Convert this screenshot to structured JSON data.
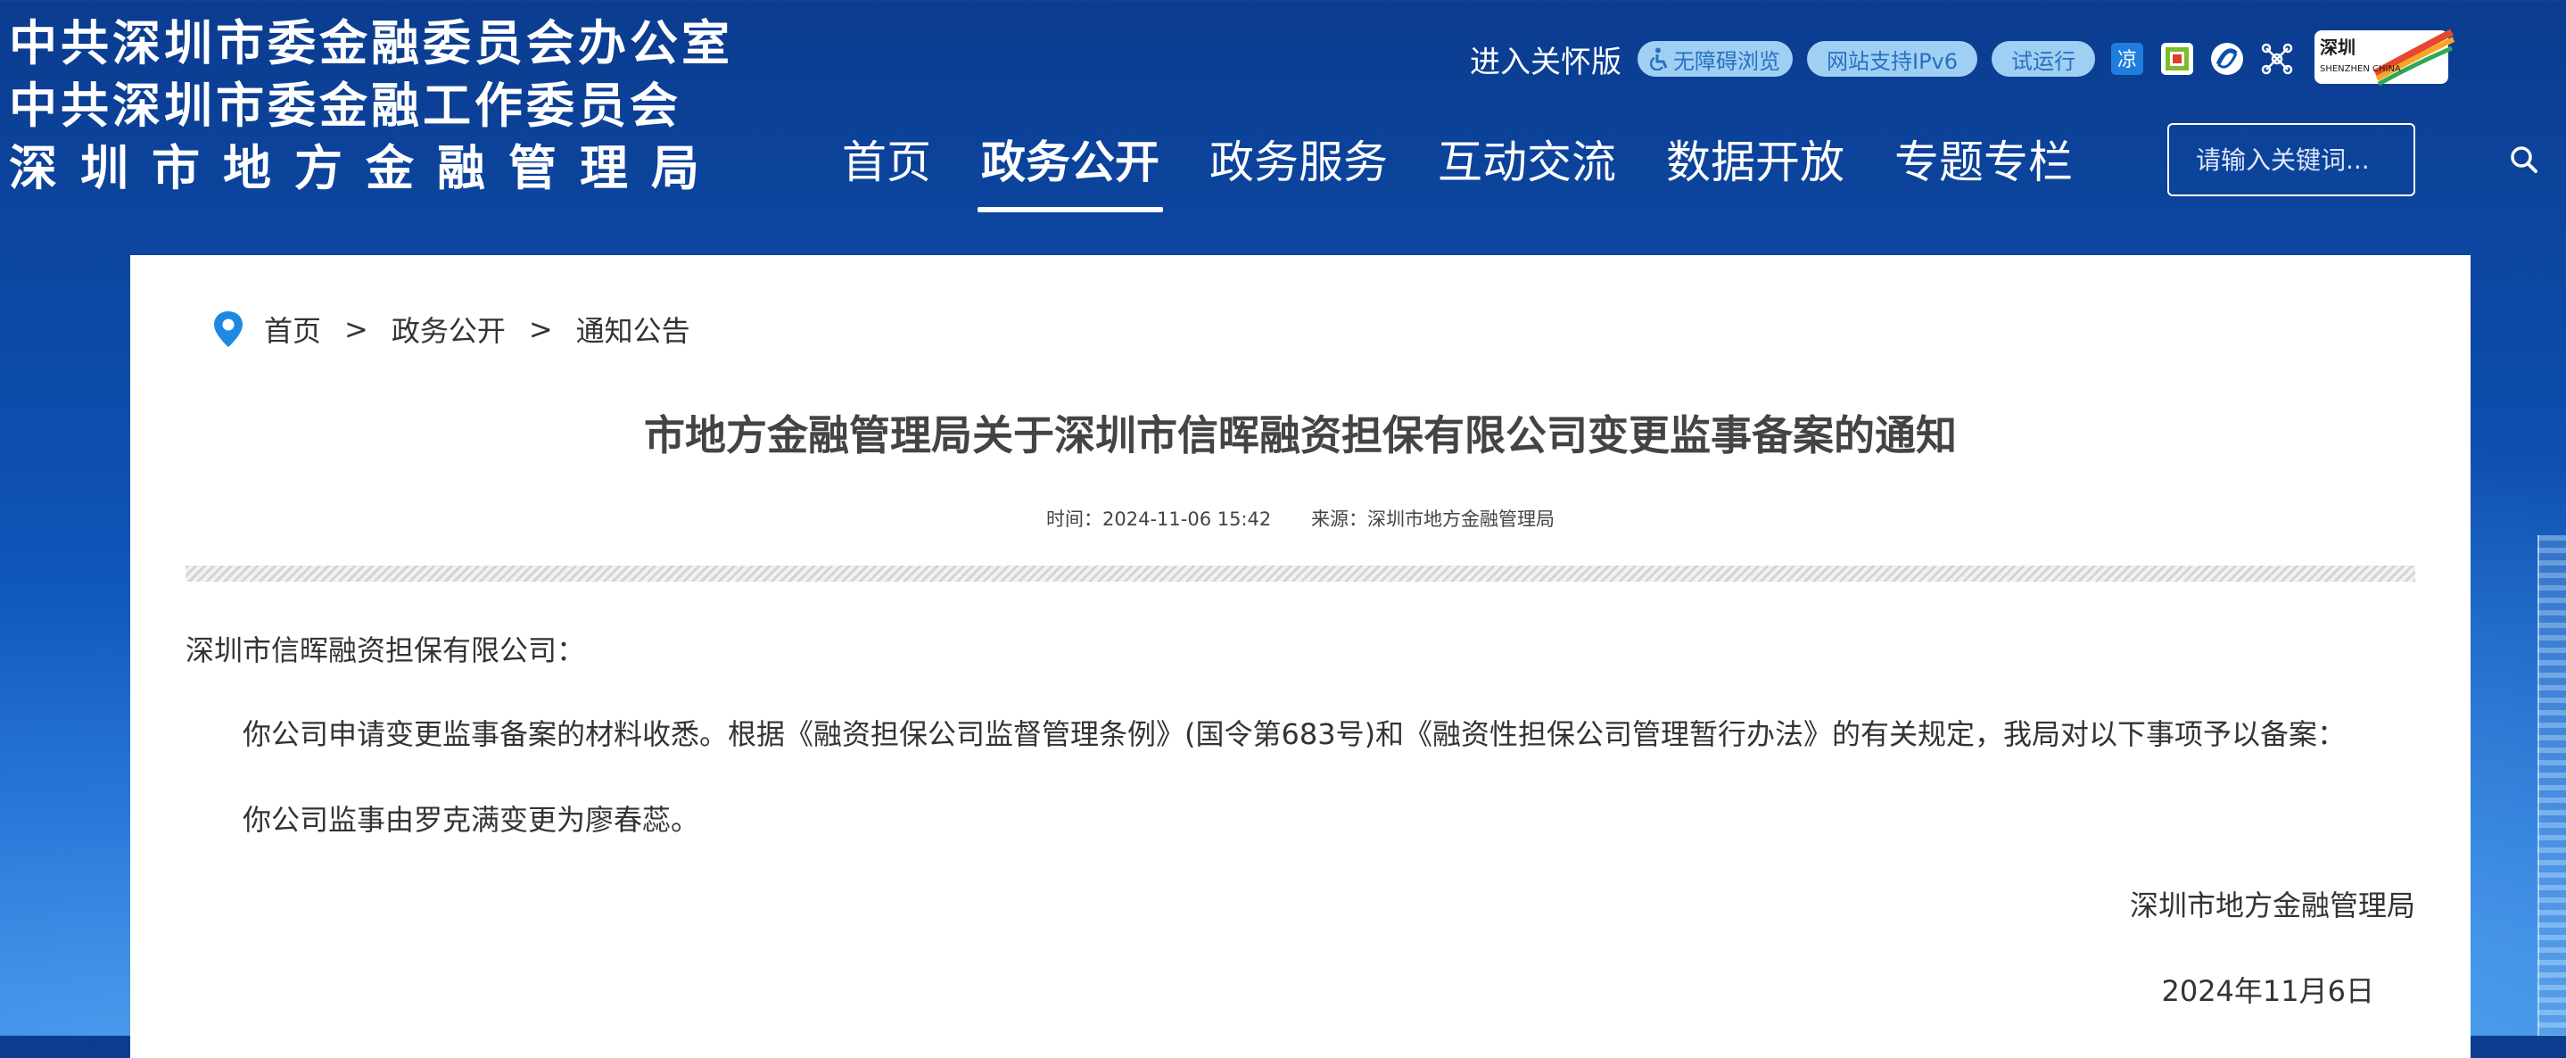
{
  "header": {
    "site_title_lines": [
      "中共深圳市委金融委员会办公室",
      "中共深圳市委金融工作委员会",
      "深圳市地方金融管理局"
    ],
    "care_version": "进入关怀版",
    "accessibility": "无障碍浏览",
    "ipv6": "网站支持IPv6",
    "trial": "试运行",
    "logo_text": "深圳 SHENZHEN CHINA"
  },
  "nav": {
    "items": [
      "首页",
      "政务公开",
      "政务服务",
      "互动交流",
      "数据开放",
      "专题专栏"
    ],
    "active": "政务公开"
  },
  "search": {
    "placeholder": "请输入关键词..."
  },
  "breadcrumb": {
    "home": "首页",
    "section": "政务公开",
    "current": "通知公告",
    "separator": ">"
  },
  "article": {
    "title": "市地方金融管理局关于深圳市信晖融资担保有限公司变更监事备案的通知",
    "time": "时间：2024-11-06 15:42",
    "source": "来源：深圳市地方金融管理局",
    "salutation": "深圳市信晖融资担保有限公司：",
    "body1": "你公司申请变更监事备案的材料收悉。根据《融资担保公司监督管理条例》(国令第683号)和《融资性担保公司管理暂行办法》的有关规定，我局对以下事项予以备案：",
    "body2": "你公司监事由罗克满变更为廖春蕊。",
    "signature": "深圳市地方金融管理局",
    "date": "2024年11月6日"
  },
  "colors": {
    "header_bg": "#0d4fb0",
    "pill_bg": "#9fd0f4",
    "pill_text": "#2a6fbf",
    "pin": "#1e88e5",
    "title_text": "#444444"
  }
}
